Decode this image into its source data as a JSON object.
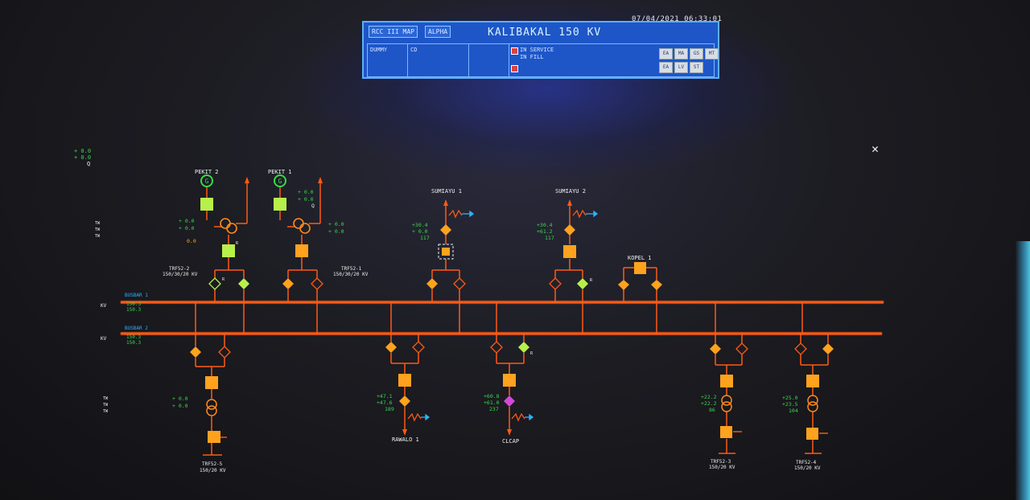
{
  "timestamp": "07/04/2021 06:33:01",
  "header": {
    "tabs": [
      "RCC III MAP",
      "ALPHA"
    ],
    "title": "KALIBAKAL 150 KV",
    "cells": [
      "DUMMY",
      "CD"
    ],
    "status_lines": [
      "IN SERVICE",
      "IN FILL"
    ],
    "buttons_row1": [
      "EA",
      "MA",
      "GS",
      "MT"
    ],
    "buttons_row2": [
      "EA",
      "LV",
      "ST"
    ]
  },
  "close_glyph": "✕",
  "colors": {
    "line": "#ff5a14",
    "device_orange": "#ffa21e",
    "device_green": "#b8f04a",
    "text_green": "#39d84a",
    "text_white": "#f0f0f0",
    "text_cyan": "#28b4ff"
  },
  "top_left_values": [
    "+ 0.0",
    "+ 0.0",
    "Q"
  ],
  "feeders_top": [
    {
      "name": "PEKIT 2",
      "values": [
        "+ 0.0",
        "+ 0.0",
        "0.0"
      ],
      "label": "TRF52-2",
      "rating": "150/30/20 KV"
    },
    {
      "name": "PEKIT 1",
      "values": [
        "+ 0.0",
        "+ 0.0",
        "Q"
      ],
      "values2": [
        "+ 0.0",
        "+ 0.0"
      ],
      "label": "TRF52-1",
      "rating": "150/30/20 KV"
    },
    {
      "name": "SUMIAYU 1",
      "values": [
        "+30.4",
        "+ 0.0",
        "117"
      ]
    },
    {
      "name": "SUMIAYU 2",
      "values": [
        "+30.4",
        "+61.2",
        "117"
      ]
    },
    {
      "name": "KOPEL 1"
    }
  ],
  "busbars": [
    {
      "label": "BUSBAR 1",
      "kv": "KV",
      "values": [
        "150.3",
        "150.3"
      ]
    },
    {
      "label": "BUSBAR 2",
      "kv": "KV",
      "values": [
        "150.3",
        "150.3"
      ]
    }
  ],
  "feeders_bottom": [
    {
      "name": "TRF52-5",
      "rating": "150/20 KV",
      "values": [
        "+ 0.0",
        "+ 0.0"
      ]
    },
    {
      "name": "RAWALO 1",
      "values": [
        "+47.1",
        "+47.6",
        "189"
      ]
    },
    {
      "name": "CLCAP",
      "values": [
        "+60.8",
        "+61.0",
        "237"
      ]
    },
    {
      "name": "TRF52-3",
      "rating": "150/20 KV",
      "values": [
        "+22.2",
        "+22.2",
        "86"
      ]
    },
    {
      "name": "TRF52-4",
      "rating": "150/20 KV",
      "values": [
        "+25.0",
        "+23.5",
        "104"
      ]
    }
  ],
  "small_tags": [
    "R",
    "R",
    "R",
    "R"
  ]
}
